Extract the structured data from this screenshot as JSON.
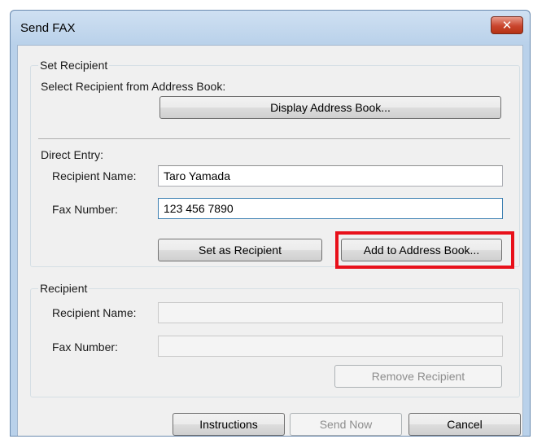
{
  "window": {
    "title": "Send FAX",
    "close_icon": "close-icon"
  },
  "set_recipient": {
    "legend": "Set Recipient",
    "select_label": "Select Recipient from Address Book:",
    "display_address_book_button": "Display Address Book..."
  },
  "direct_entry": {
    "label": "Direct Entry:",
    "recipient_name_label": "Recipient Name:",
    "recipient_name_value": "Taro Yamada",
    "fax_number_label": "Fax Number:",
    "fax_number_value": "123 456 7890",
    "set_as_recipient_button": "Set as Recipient",
    "add_to_address_book_button": "Add to Address Book..."
  },
  "recipient": {
    "legend": "Recipient",
    "recipient_name_label": "Recipient Name:",
    "recipient_name_value": "",
    "fax_number_label": "Fax Number:",
    "fax_number_value": "",
    "remove_recipient_button": "Remove Recipient"
  },
  "footer": {
    "instructions_button": "Instructions",
    "send_now_button": "Send Now",
    "cancel_button": "Cancel"
  },
  "colors": {
    "highlight": "#e8101a",
    "title_bar": "#b9d1ea",
    "close_button": "#c9452d"
  }
}
